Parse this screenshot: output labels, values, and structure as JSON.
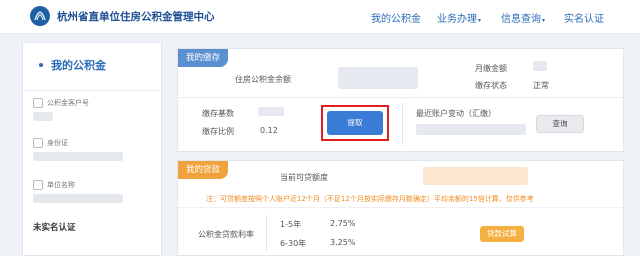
{
  "header": {
    "site_title": "杭州省直单位住房公积金管理中心",
    "nav": [
      {
        "label": "我的公积金",
        "caret": ""
      },
      {
        "label": "业务办理",
        "caret": "▾"
      },
      {
        "label": "信息查询",
        "caret": "▾"
      },
      {
        "label": "实名认证",
        "caret": ""
      }
    ]
  },
  "sidebar": {
    "title": "我的公积金",
    "items": [
      {
        "label": "公积金客户号"
      },
      {
        "label": "身份证"
      },
      {
        "label": "单位名称"
      }
    ],
    "status": "未实名认证"
  },
  "deposit": {
    "tag": "我的缴存",
    "balance_label": "住房公积金余额",
    "monthly_label": "月缴金额",
    "status_label": "缴存状态",
    "status_value": "正常",
    "base_label": "缴存基数",
    "ratio_label": "缴存比例",
    "ratio_value": "0.12",
    "withdraw_button": "提取",
    "recent_change_label": "最近账户变动（汇缴）",
    "query_button": "查询"
  },
  "loan": {
    "tag": "我的贷款",
    "available_label": "当前可贷额度",
    "notice": "注：可贷额度按照个人账户近12个月（不足12个月按实际缴存月数确定）平均余额的15倍计算，仅供参考",
    "rate_label": "公积金贷款利率",
    "rates": [
      {
        "term": "1-5年",
        "rate": "2.75%"
      },
      {
        "term": "6-30年",
        "rate": "3.25%"
      }
    ],
    "calc_button": "贷款试算"
  },
  "colors": {
    "brand": "#1f4f94",
    "accent": "#2a6bb8",
    "highlight": "#e02020",
    "orange": "#f0a23c"
  }
}
